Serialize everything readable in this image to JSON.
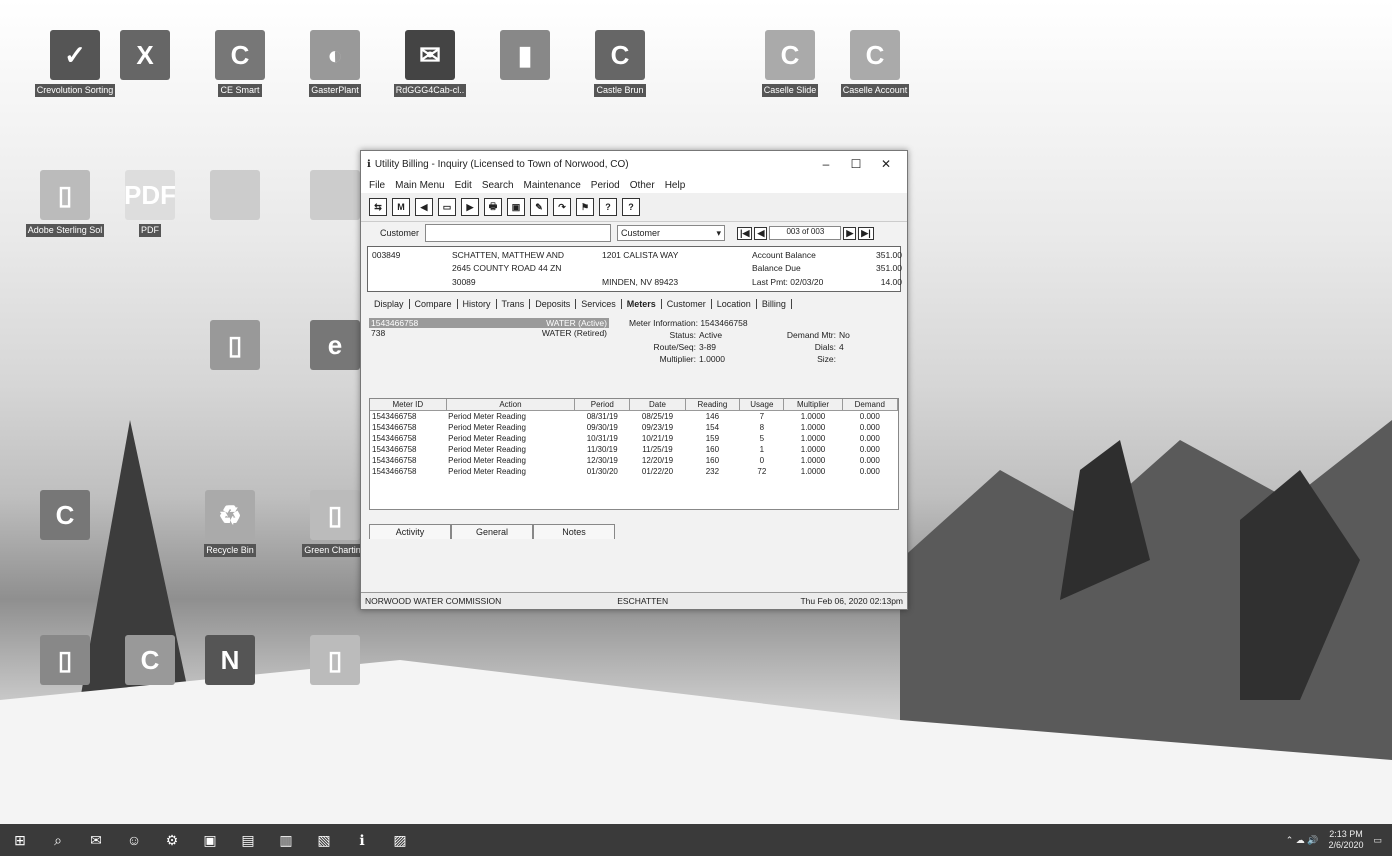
{
  "desktop_icons": [
    {
      "label": "Crevolution Sorting",
      "glyph": "✓"
    },
    {
      "label": "",
      "glyph": "X"
    },
    {
      "label": "CE Smart",
      "glyph": "C"
    },
    {
      "label": "GasterPlant",
      "glyph": "◐"
    },
    {
      "label": "RdGGG4Cab-cl..",
      "glyph": "✉"
    },
    {
      "label": "",
      "glyph": "▮"
    },
    {
      "label": "Castle Brun",
      "glyph": "C"
    },
    {
      "label": "Caselle Slide",
      "glyph": "C"
    },
    {
      "label": "Caselle Account",
      "glyph": "C"
    },
    {
      "label": "Adobe Sterling Sol",
      "glyph": "▯"
    },
    {
      "label": "PDF",
      "glyph": "PDF"
    },
    {
      "label": "",
      "glyph": ""
    },
    {
      "label": "",
      "glyph": ""
    },
    {
      "label": "",
      "glyph": "e"
    },
    {
      "label": "",
      "glyph": "▯"
    },
    {
      "label": "",
      "glyph": "C"
    },
    {
      "label": "Recycle Bin",
      "glyph": "♻"
    },
    {
      "label": "Green Charting",
      "glyph": "▯"
    },
    {
      "label": "",
      "glyph": "▯"
    },
    {
      "label": "",
      "glyph": "C"
    },
    {
      "label": "",
      "glyph": "N"
    },
    {
      "label": "",
      "glyph": "▯"
    }
  ],
  "window": {
    "title": "Utility Billing - Inquiry  (Licensed to Town of Norwood, CO)",
    "minimize": "–",
    "maximize": "☐",
    "close": "✕",
    "menu": [
      "File",
      "Main Menu",
      "Edit",
      "Search",
      "Maintenance",
      "Period",
      "Other",
      "Help"
    ],
    "toolbar": [
      "⇆",
      "M",
      "◀",
      "▭",
      "▶",
      "🖶",
      "▣",
      "✎",
      "↷",
      "⚑",
      "?",
      "?"
    ],
    "customer_label": "Customer",
    "customer_value": "",
    "search_by": "Customer",
    "record_nav": "003 of 003",
    "account": {
      "number": "003849",
      "name": "SCHATTEN, MATTHEW AND",
      "address1": "2645 COUNTY ROAD 44 ZN",
      "address2": "30089",
      "service_addr": "1201 CALISTA WAY",
      "city": "MINDEN, NV 89423",
      "balance_label": "Account Balance",
      "balance": "351.00",
      "due_label": "Balance Due",
      "due": "351.00",
      "lastpmt_label": "Last Pmt: 02/03/20",
      "lastpmt": "14.00"
    },
    "tabs": [
      "Display",
      "Compare",
      "History",
      "Trans",
      "Deposits",
      "Services",
      "Meters",
      "Customer",
      "Location",
      "Billing"
    ],
    "active_tab": "Meters",
    "meter_list": [
      {
        "id": "1543466758",
        "desc": "WATER (Active)"
      },
      {
        "id": "738",
        "desc": "WATER (Retired)"
      }
    ],
    "meter_info": {
      "title": "Meter Information: 1543466758",
      "status_label": "Status:",
      "status": "Active",
      "demand_label": "Demand Mtr:",
      "demand": "No",
      "route_label": "Route/Seq:",
      "route": "3-89",
      "dials_label": "Dials:",
      "dials": "4",
      "mult_label": "Multiplier:",
      "mult": "1.0000",
      "size_label": "Size:",
      "size": ""
    },
    "grid_headers": [
      "Meter ID",
      "Action",
      "Period",
      "Date",
      "Reading",
      "Usage",
      "Multiplier",
      "Demand"
    ],
    "grid_rows": [
      [
        "1543466758",
        "Period Meter Reading",
        "08/31/19",
        "08/25/19",
        "146",
        "7",
        "1.0000",
        "0.000"
      ],
      [
        "1543466758",
        "Period Meter Reading",
        "09/30/19",
        "09/23/19",
        "154",
        "8",
        "1.0000",
        "0.000"
      ],
      [
        "1543466758",
        "Period Meter Reading",
        "10/31/19",
        "10/21/19",
        "159",
        "5",
        "1.0000",
        "0.000"
      ],
      [
        "1543466758",
        "Period Meter Reading",
        "11/30/19",
        "11/25/19",
        "160",
        "1",
        "1.0000",
        "0.000"
      ],
      [
        "1543466758",
        "Period Meter Reading",
        "12/30/19",
        "12/20/19",
        "160",
        "0",
        "1.0000",
        "0.000"
      ],
      [
        "1543466758",
        "Period Meter Reading",
        "01/30/20",
        "01/22/20",
        "232",
        "72",
        "1.0000",
        "0.000"
      ]
    ],
    "bottom_tabs": [
      "Activity",
      "General",
      "Notes"
    ],
    "status_left": "NORWOOD WATER COMMISSION",
    "status_mid": "ESCHATTEN",
    "status_right": "Thu Feb 06, 2020  02:13pm"
  },
  "taskbar": {
    "icons": [
      "⊞",
      "⌕",
      "✉",
      "☺",
      "⚙",
      "▣",
      "▤",
      "▥",
      "▧",
      "ℹ",
      "▨"
    ],
    "tray": "⌃ ☁ 🔊",
    "time": "2:13 PM",
    "date": "2/6/2020",
    "notify": "▭"
  }
}
